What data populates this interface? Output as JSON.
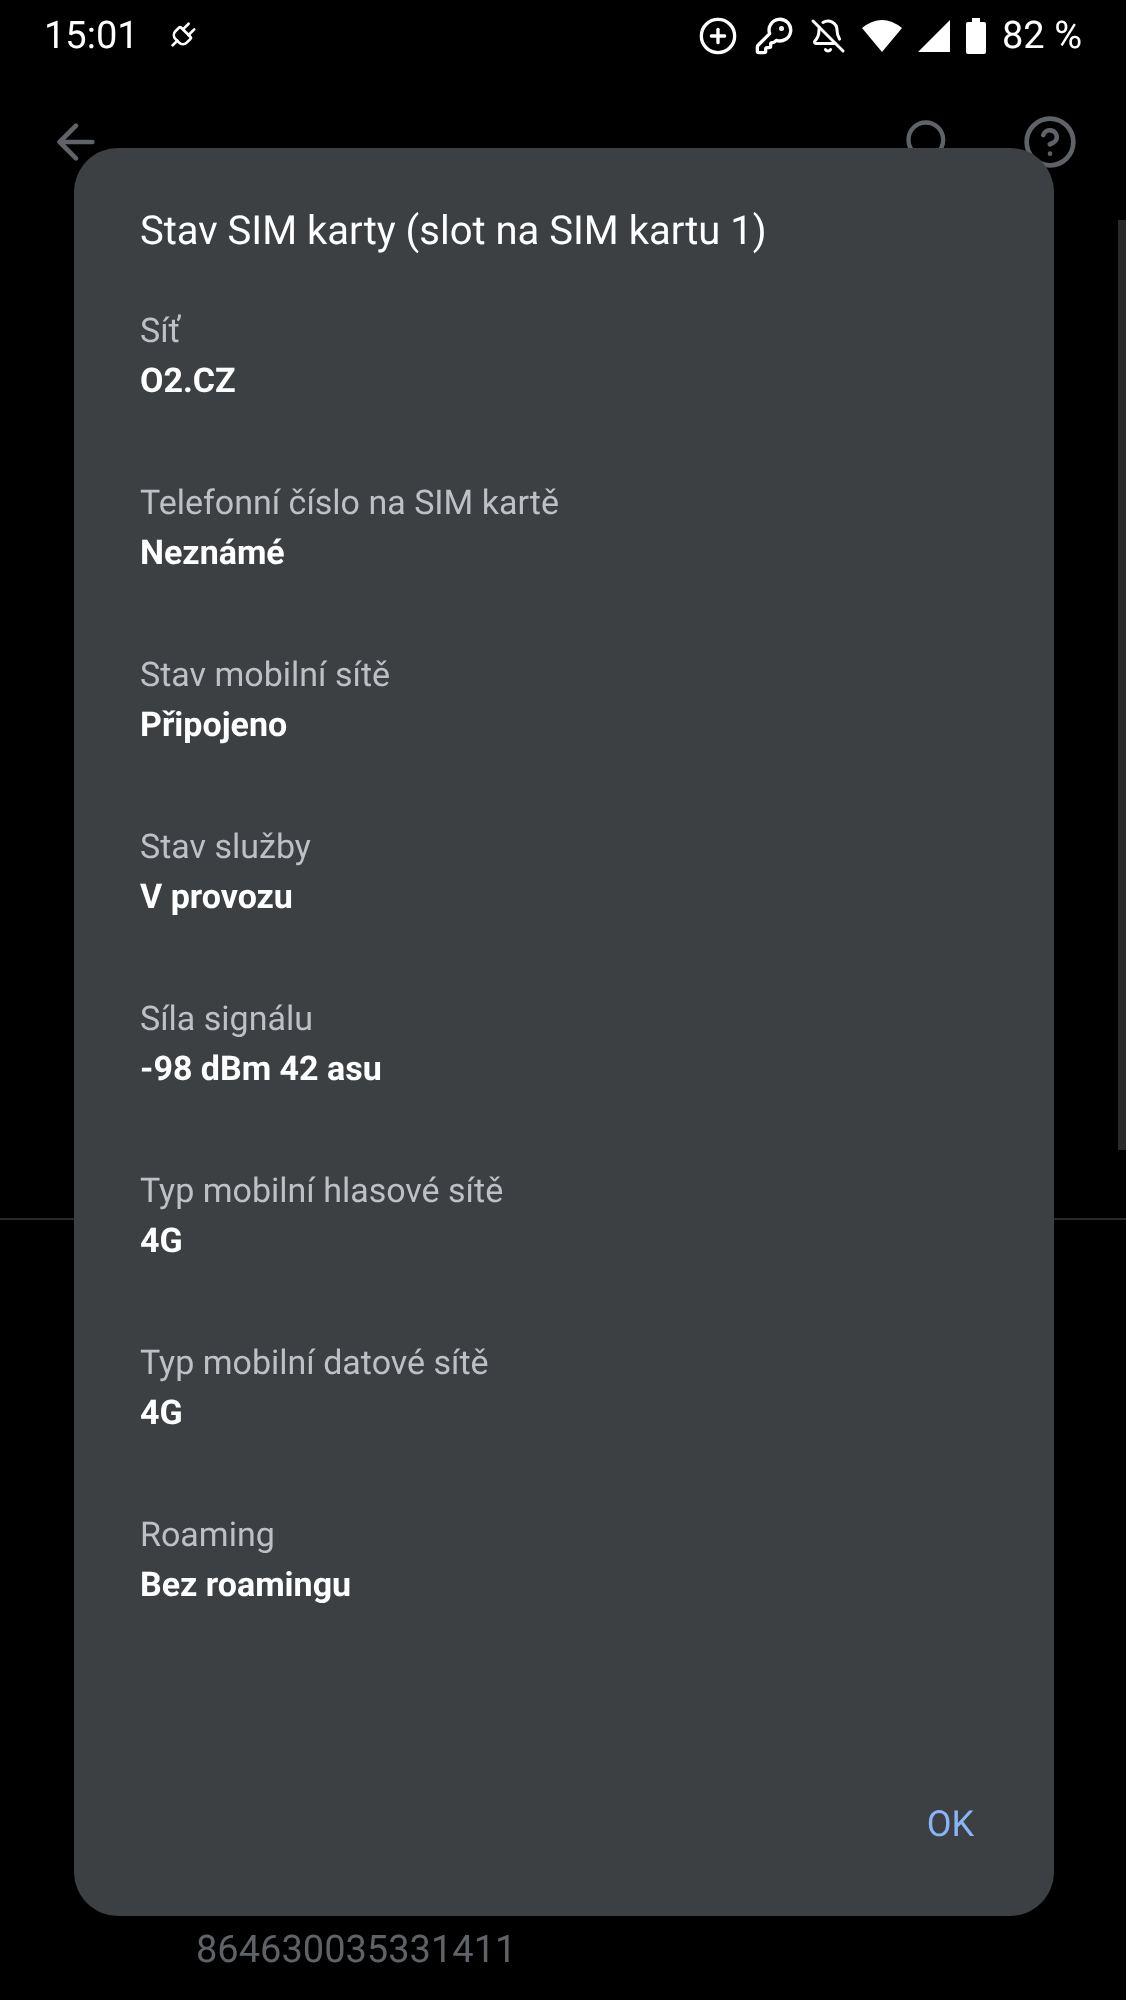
{
  "status_bar": {
    "time": "15:01",
    "battery": "82 %"
  },
  "background": {
    "value": "864630035331411"
  },
  "dialog": {
    "title": "Stav SIM karty (slot na SIM kartu 1)",
    "items": [
      {
        "label": "Síť",
        "value": "O2.CZ"
      },
      {
        "label": "Telefonní číslo na SIM kartě",
        "value": "Neznámé"
      },
      {
        "label": "Stav mobilní sítě",
        "value": "Připojeno"
      },
      {
        "label": "Stav služby",
        "value": "V provozu"
      },
      {
        "label": "Síla signálu",
        "value": "-98 dBm 42 asu"
      },
      {
        "label": "Typ mobilní hlasové sítě",
        "value": "4G"
      },
      {
        "label": "Typ mobilní datové sítě",
        "value": "4G"
      },
      {
        "label": "Roaming",
        "value": "Bez roamingu"
      }
    ],
    "button": "OK"
  }
}
